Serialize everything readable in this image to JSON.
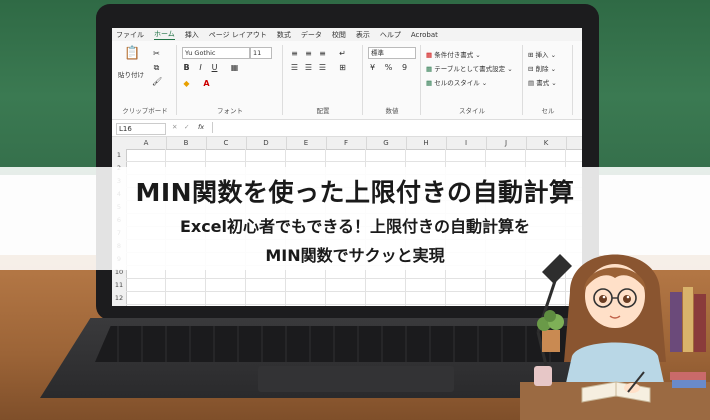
{
  "excel": {
    "menu_tabs": [
      "ファイル",
      "ホーム",
      "挿入",
      "ページ レイアウト",
      "数式",
      "データ",
      "校閲",
      "表示",
      "ヘルプ",
      "Acrobat"
    ],
    "active_tab": "ホーム",
    "ribbon": {
      "paste_label": "貼り付け",
      "clipboard_group": "クリップボード",
      "font_name": "Yu Gothic",
      "font_size": "11",
      "font_group": "フォント",
      "bold": "B",
      "italic": "I",
      "underline": "U",
      "alignment_group": "配置",
      "number_format": "標準",
      "percent": "%",
      "comma": "9",
      "number_group": "数値",
      "conditional_format": "条件付き書式",
      "format_as_table": "テーブルとして書式設定",
      "cell_styles": "セルのスタイル",
      "styles_group": "スタイル",
      "insert": "挿入",
      "delete": "削除",
      "format": "書式",
      "cells_group": "セル"
    },
    "name_box": "L16",
    "fx": "fx",
    "columns": [
      "A",
      "B",
      "C",
      "D",
      "E",
      "F",
      "G",
      "H",
      "I",
      "J",
      "K"
    ],
    "rows": [
      "1",
      "2",
      "3",
      "4",
      "5",
      "6",
      "7",
      "8",
      "9",
      "10",
      "11",
      "12"
    ]
  },
  "banner": {
    "title": "MIN関数を使った上限付きの自動計算",
    "subtitle_line1": "Excel初心者でもできる！上限付きの自動計算を",
    "subtitle_line2": "MIN関数でサクッと実現"
  },
  "colors": {
    "excel_green": "#217346",
    "board_green": "#2f6a45",
    "desk_wood": "#a86b3c"
  }
}
